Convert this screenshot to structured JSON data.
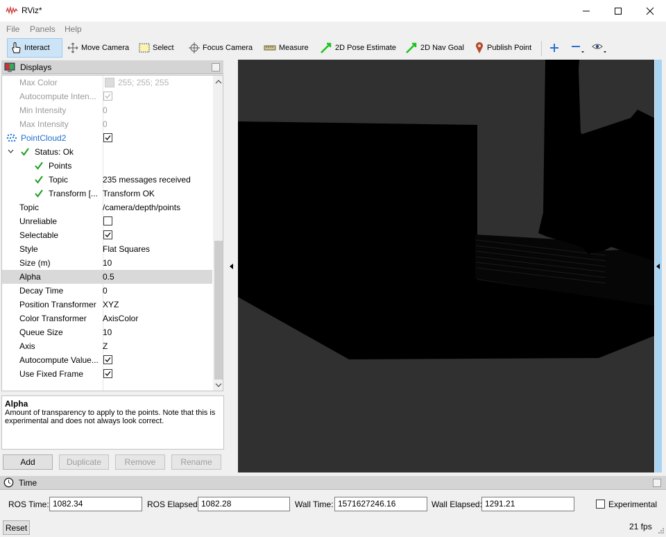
{
  "window": {
    "title": "RViz*"
  },
  "menu": [
    "File",
    "Panels",
    "Help"
  ],
  "toolbar": {
    "interact": "Interact",
    "move_camera": "Move Camera",
    "select": "Select",
    "focus_camera": "Focus Camera",
    "measure": "Measure",
    "pose_estimate": "2D Pose Estimate",
    "nav_goal": "2D Nav Goal",
    "publish_point": "Publish Point"
  },
  "displays": {
    "title": "Displays",
    "rows": [
      {
        "name": "Max Color",
        "value": "255; 255; 255"
      },
      {
        "name": "Autocompute Inten...",
        "value": ""
      },
      {
        "name": "Min Intensity",
        "value": "0"
      },
      {
        "name": "Max Intensity",
        "value": "0"
      },
      {
        "name": "PointCloud2",
        "value": ""
      },
      {
        "name": "Status: Ok",
        "value": ""
      },
      {
        "name": "Points",
        "value": ""
      },
      {
        "name": "Topic",
        "value": "235 messages received"
      },
      {
        "name": "Transform [...",
        "value": "Transform OK"
      },
      {
        "name": "Topic",
        "value": "/camera/depth/points"
      },
      {
        "name": "Unreliable",
        "value": ""
      },
      {
        "name": "Selectable",
        "value": ""
      },
      {
        "name": "Style",
        "value": "Flat Squares"
      },
      {
        "name": "Size (m)",
        "value": "10"
      },
      {
        "name": "Alpha",
        "value": "0.5"
      },
      {
        "name": "Decay Time",
        "value": "0"
      },
      {
        "name": "Position Transformer",
        "value": "XYZ"
      },
      {
        "name": "Color Transformer",
        "value": "AxisColor"
      },
      {
        "name": "Queue Size",
        "value": "10"
      },
      {
        "name": "Axis",
        "value": "Z"
      },
      {
        "name": "Autocompute Value...",
        "value": ""
      },
      {
        "name": "Use Fixed Frame",
        "value": ""
      }
    ]
  },
  "description": {
    "title": "Alpha",
    "text": "Amount of transparency to apply to the points. Note that this is experimental and does not always look correct."
  },
  "panel_buttons": {
    "add": "Add",
    "duplicate": "Duplicate",
    "remove": "Remove",
    "rename": "Rename"
  },
  "time": {
    "title": "Time",
    "ros_time_label": "ROS Time:",
    "ros_time": "1082.34",
    "ros_elapsed_label": "ROS Elapsed:",
    "ros_elapsed": "1082.28",
    "wall_time_label": "Wall Time:",
    "wall_time": "1571627246.16",
    "wall_elapsed_label": "Wall Elapsed:",
    "wall_elapsed": "1291.21",
    "experimental_label": "Experimental"
  },
  "status": {
    "reset": "Reset",
    "fps": "21 fps"
  },
  "colors": {
    "view_bg": "#303030",
    "geometry": "#000000",
    "accent": "#0078d7",
    "ok_check": "#1a9c1a"
  }
}
